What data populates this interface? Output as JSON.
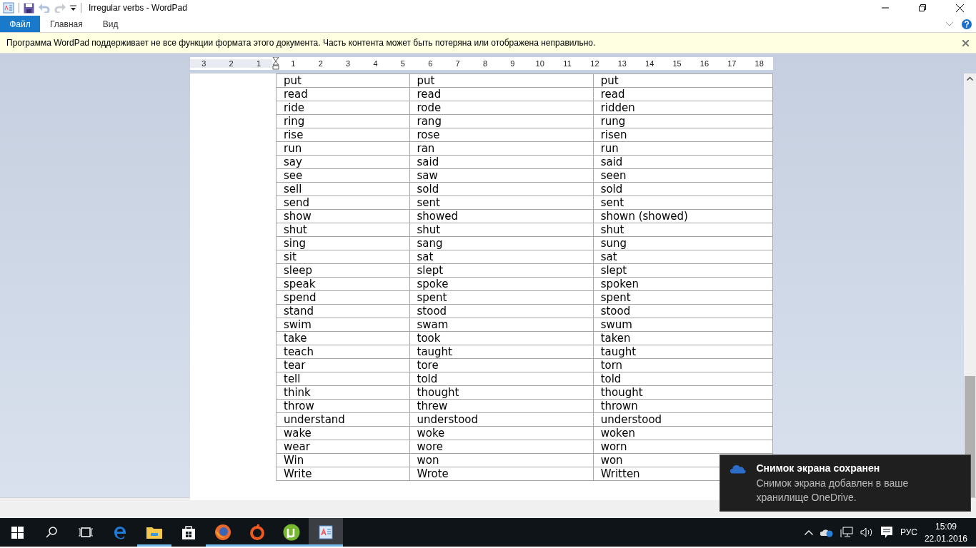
{
  "window": {
    "title": "Irregular verbs - WordPad"
  },
  "ribbon_tabs": [
    {
      "label": "Файл",
      "selected": true
    },
    {
      "label": "Главная",
      "selected": false
    },
    {
      "label": "Вид",
      "selected": false
    }
  ],
  "info_bar": {
    "message": "Программа WordPad поддерживает не все функции формата этого документа. Часть контента может быть потеряна или отображена неправильно."
  },
  "ruler": {
    "left_labels": [
      "3",
      "2",
      "1"
    ],
    "right_labels": [
      "1",
      "2",
      "3",
      "4",
      "5",
      "6",
      "7",
      "8",
      "9",
      "10",
      "11",
      "12",
      "13",
      "14",
      "15",
      "16",
      "17",
      "18"
    ]
  },
  "table": {
    "rows": [
      [
        "put",
        "put",
        "put"
      ],
      [
        "read",
        "read",
        "read"
      ],
      [
        "ride",
        "rode",
        "ridden"
      ],
      [
        "ring",
        "rang",
        "rung"
      ],
      [
        "rise",
        "rose",
        "risen"
      ],
      [
        "run",
        "ran",
        "run"
      ],
      [
        "say",
        "said",
        "said"
      ],
      [
        "see",
        "saw",
        "seen"
      ],
      [
        "sell",
        "sold",
        "sold"
      ],
      [
        "send",
        "sent",
        "sent"
      ],
      [
        "show",
        "showed",
        "shown (showed)"
      ],
      [
        "shut",
        "shut",
        "shut"
      ],
      [
        "sing",
        "sang",
        "sung"
      ],
      [
        "sit",
        "sat",
        "sat"
      ],
      [
        "sleep",
        "slept",
        "slept"
      ],
      [
        "speak",
        "spoke",
        "spoken"
      ],
      [
        "spend",
        "spent",
        "spent"
      ],
      [
        "stand",
        "stood",
        "stood"
      ],
      [
        "swim",
        "swam",
        "swum"
      ],
      [
        "take",
        "took",
        "taken"
      ],
      [
        "teach",
        "taught",
        "taught"
      ],
      [
        "tear",
        "tore",
        "torn"
      ],
      [
        "tell",
        "told",
        "told"
      ],
      [
        "think",
        "thought",
        "thought"
      ],
      [
        "throw",
        "threw",
        "thrown"
      ],
      [
        "understand",
        "understood",
        "understood"
      ],
      [
        "wake",
        "woke",
        "woken"
      ],
      [
        "wear",
        "wore",
        "worn"
      ],
      [
        "Win",
        "won",
        "won"
      ],
      [
        "Write",
        "Wrote",
        "Written"
      ]
    ]
  },
  "notification": {
    "title": "Снимок экрана сохранен",
    "body": "Снимок экрана добавлен в ваше хранилище OneDrive."
  },
  "taskbar": {
    "apps": [
      {
        "kind": "edge",
        "running": false,
        "selected": false
      },
      {
        "kind": "explorer",
        "running": true,
        "selected": false
      },
      {
        "kind": "store",
        "running": false,
        "selected": false
      },
      {
        "kind": "firefox",
        "running": true,
        "selected": false
      },
      {
        "kind": "origin",
        "running": true,
        "selected": false
      },
      {
        "kind": "utorrent",
        "running": true,
        "selected": false
      },
      {
        "kind": "wordpad",
        "running": true,
        "selected": true
      }
    ],
    "language": "РУС",
    "time": "15:09",
    "date": "22.01.2016"
  }
}
